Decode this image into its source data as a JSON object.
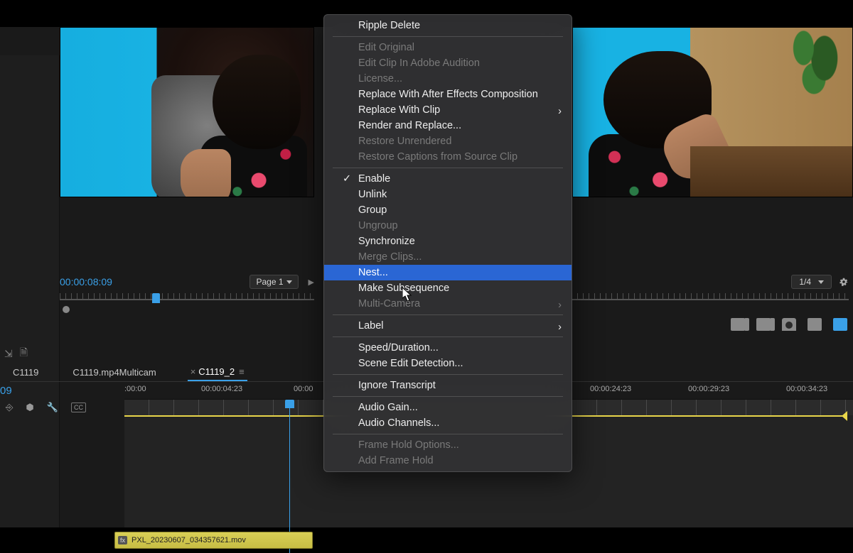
{
  "source_monitor": {
    "timecode": "00:00:08:09",
    "page_label": "Page 1"
  },
  "program_monitor": {
    "resolution": "1/4"
  },
  "sequences": {
    "tabs": [
      "C1119",
      "C1119.mp4Multicam",
      "C1119_2"
    ],
    "active_index": 2
  },
  "timeline": {
    "playhead_timecode": "09",
    "ruler_labels": [
      ":00:00",
      "00:00:04:23",
      "00:00",
      "00:00:24:23",
      "00:00:29:23",
      "00:00:34:23"
    ],
    "clip_name": "PXL_20230607_034357621.mov"
  },
  "context_menu": {
    "groups": [
      [
        {
          "label": "Ripple Delete",
          "state": "enabled"
        }
      ],
      [
        {
          "label": "Edit Original",
          "state": "disabled"
        },
        {
          "label": "Edit Clip In Adobe Audition",
          "state": "disabled"
        },
        {
          "label": "License...",
          "state": "disabled"
        },
        {
          "label": "Replace With After Effects Composition",
          "state": "enabled"
        },
        {
          "label": "Replace With Clip",
          "state": "enabled",
          "submenu": true
        },
        {
          "label": "Render and Replace...",
          "state": "enabled"
        },
        {
          "label": "Restore Unrendered",
          "state": "disabled"
        },
        {
          "label": "Restore Captions from Source Clip",
          "state": "disabled"
        }
      ],
      [
        {
          "label": "Enable",
          "state": "enabled",
          "checked": true
        },
        {
          "label": "Unlink",
          "state": "enabled"
        },
        {
          "label": "Group",
          "state": "enabled"
        },
        {
          "label": "Ungroup",
          "state": "disabled"
        },
        {
          "label": "Synchronize",
          "state": "enabled"
        },
        {
          "label": "Merge Clips...",
          "state": "disabled"
        },
        {
          "label": "Nest...",
          "state": "highlight"
        },
        {
          "label": "Make Subsequence",
          "state": "enabled"
        },
        {
          "label": "Multi-Camera",
          "state": "disabled",
          "submenu": true
        }
      ],
      [
        {
          "label": "Label",
          "state": "enabled",
          "submenu": true
        }
      ],
      [
        {
          "label": "Speed/Duration...",
          "state": "enabled"
        },
        {
          "label": "Scene Edit Detection...",
          "state": "enabled"
        }
      ],
      [
        {
          "label": "Ignore Transcript",
          "state": "enabled"
        }
      ],
      [
        {
          "label": "Audio Gain...",
          "state": "enabled"
        },
        {
          "label": "Audio Channels...",
          "state": "enabled"
        }
      ],
      [
        {
          "label": "Frame Hold Options...",
          "state": "disabled"
        },
        {
          "label": "Add Frame Hold",
          "state": "disabled"
        }
      ]
    ]
  }
}
